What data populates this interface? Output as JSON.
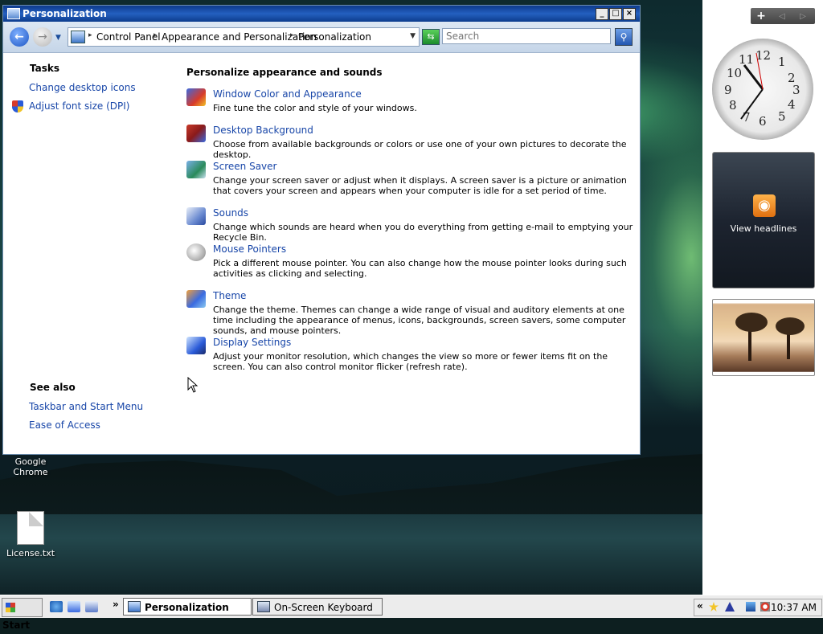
{
  "window": {
    "title": "Personalization",
    "minimize": "_",
    "maximize": "□",
    "close": "×"
  },
  "address": {
    "crumbs": [
      "Control Panel",
      "Appearance and Personalization",
      "Personalization"
    ],
    "search_placeholder": "Search"
  },
  "tasks": {
    "heading": "Tasks",
    "links": [
      "Change desktop icons",
      "Adjust font size (DPI)"
    ]
  },
  "see_also": {
    "heading": "See also",
    "links": [
      "Taskbar and Start Menu",
      "Ease of Access"
    ]
  },
  "main": {
    "title": "Personalize appearance and sounds",
    "items": [
      {
        "title": "Window Color and Appearance",
        "desc": "Fine tune the color and style of your windows.",
        "icon": "window-color-icon"
      },
      {
        "title": "Desktop Background",
        "desc": "Choose from available backgrounds or colors or use one of your own pictures to decorate the desktop.",
        "icon": "desktop-background-icon"
      },
      {
        "title": "Screen Saver",
        "desc": "Change your screen saver or adjust when it displays. A screen saver is a picture or animation that covers your screen and appears when your computer is idle for a set period of time.",
        "icon": "screen-saver-icon"
      },
      {
        "title": "Sounds",
        "desc": "Change which sounds are heard when you do everything from getting e-mail to emptying your Recycle Bin.",
        "icon": "sounds-icon"
      },
      {
        "title": "Mouse Pointers",
        "desc": "Pick a different mouse pointer. You can also change how the mouse pointer looks during such activities as clicking and selecting.",
        "icon": "mouse-pointers-icon"
      },
      {
        "title": "Theme",
        "desc": "Change the theme. Themes can change a wide range of visual and auditory elements at one time including the appearance of menus, icons, backgrounds, screen savers, some computer sounds, and mouse pointers.",
        "icon": "theme-icon"
      },
      {
        "title": "Display Settings",
        "desc": "Adjust your monitor resolution, which changes the view so more or fewer items fit on the screen. You can also control monitor flicker (refresh rate).",
        "icon": "display-settings-icon"
      }
    ]
  },
  "desktop": {
    "icons": [
      "Google Chrome",
      "License.txt"
    ]
  },
  "sidebar": {
    "add": "+",
    "prev": "◁",
    "next": "▷",
    "clock_numbers": [
      "12",
      "1",
      "2",
      "3",
      "4",
      "5",
      "6",
      "7",
      "8",
      "9",
      "10",
      "11"
    ],
    "rss_label": "View headlines"
  },
  "taskbar": {
    "start": "Start",
    "chevron": "»",
    "tasks": [
      "Personalization",
      "On-Screen Keyboard"
    ],
    "tray_chevron": "«",
    "time": "10:37 AM"
  },
  "colors": {
    "link": "#1846a8",
    "title_bar": "#2460c0"
  }
}
